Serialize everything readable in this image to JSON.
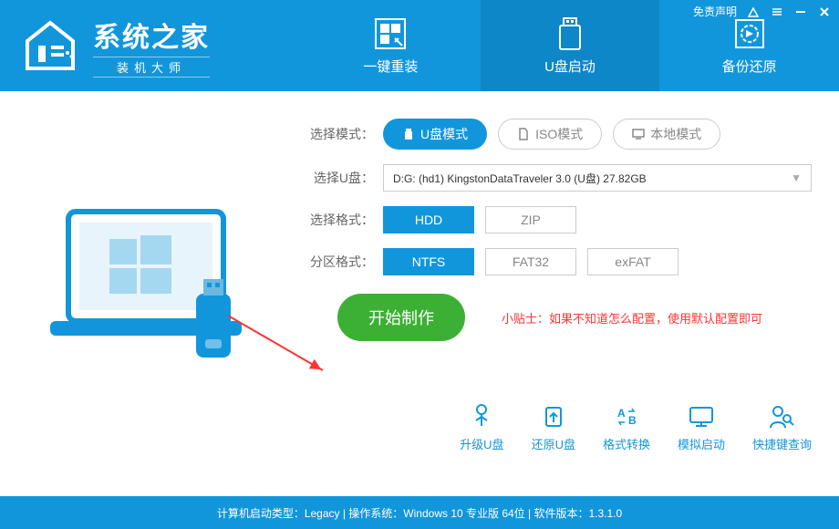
{
  "header": {
    "brand": "系统之家",
    "subtitle": "装机大师",
    "disclaimer": "免责声明",
    "tabs": [
      {
        "label": "一键重装"
      },
      {
        "label": "U盘启动"
      },
      {
        "label": "备份还原"
      }
    ]
  },
  "form": {
    "mode_label": "选择模式：",
    "modes": [
      {
        "label": "U盘模式"
      },
      {
        "label": "ISO模式"
      },
      {
        "label": "本地模式"
      }
    ],
    "drive_label": "选择U盘：",
    "drive_value": "D:G: (hd1) KingstonDataTraveler 3.0 (U盘) 27.82GB",
    "format_label": "选择格式：",
    "formats": [
      "HDD",
      "ZIP"
    ],
    "partition_label": "分区格式：",
    "partitions": [
      "NTFS",
      "FAT32",
      "exFAT"
    ],
    "start_label": "开始制作",
    "tip": "小贴士：如果不知道怎么配置，使用默认配置即可"
  },
  "tools": [
    {
      "label": "升级U盘"
    },
    {
      "label": "还原U盘"
    },
    {
      "label": "格式转换"
    },
    {
      "label": "模拟启动"
    },
    {
      "label": "快捷键查询"
    }
  ],
  "statusbar": "计算机启动类型：Legacy | 操作系统：Windows 10 专业版 64位 | 软件版本：1.3.1.0"
}
